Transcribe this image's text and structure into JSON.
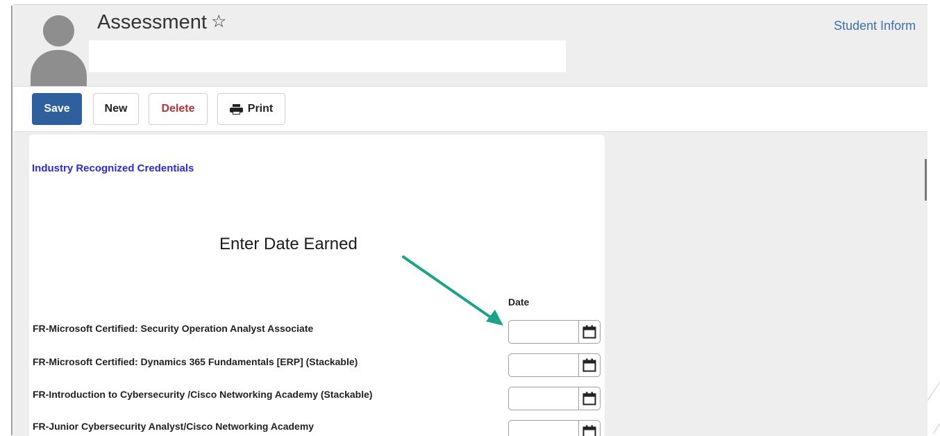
{
  "header": {
    "title": "Assessment",
    "star_icon": "star-outline-icon",
    "breadcrumb": "Student Inform"
  },
  "toolbar": {
    "save_label": "Save",
    "new_label": "New",
    "delete_label": "Delete",
    "print_label": "Print",
    "print_icon": "printer-icon"
  },
  "colors": {
    "save_button": "#2f5f9c",
    "delete_text": "#b23333",
    "section_title": "#2a2ad8",
    "breadcrumb": "#3e6fae",
    "annotation_arrow": "#1aa386"
  },
  "form": {
    "section_title": "Industry Recognized Credentials",
    "annotation": "Enter Date Earned",
    "date_column_header": "Date",
    "calendar_icon": "calendar-icon",
    "rows": [
      {
        "label": "FR-Microsoft Certified: Security Operation Analyst Associate",
        "date": ""
      },
      {
        "label": "FR-Microsoft Certified: Dynamics 365 Fundamentals [ERP] (Stackable)",
        "date": ""
      },
      {
        "label": "FR-Introduction to Cybersecurity /Cisco Networking Academy (Stackable)",
        "date": ""
      },
      {
        "label": "FR-Junior Cybersecurity Analyst/Cisco Networking Academy",
        "date": ""
      }
    ]
  }
}
